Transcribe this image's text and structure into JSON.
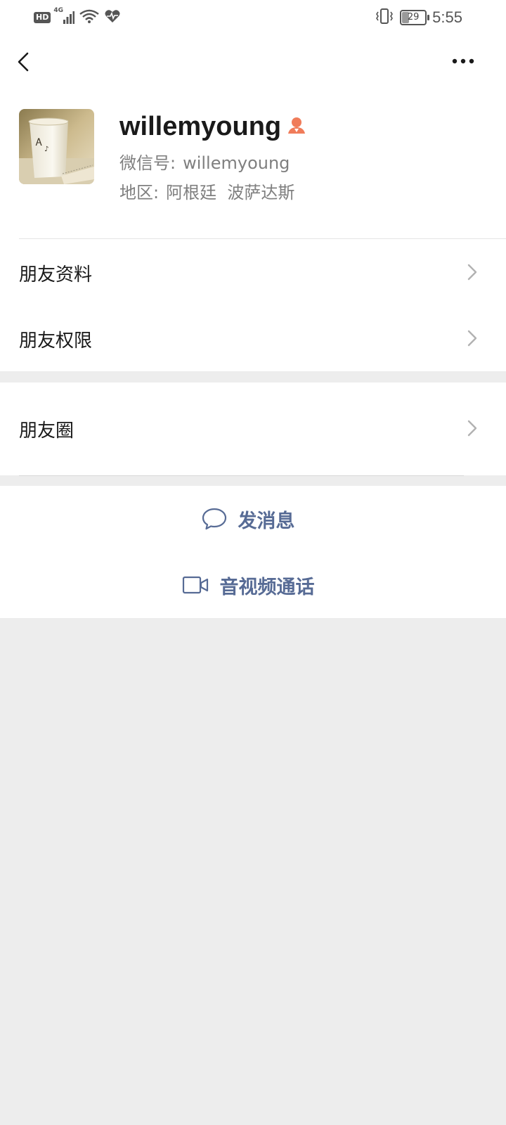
{
  "status_bar": {
    "hd": "HD",
    "network": "4G",
    "battery": "29",
    "time": "5:55"
  },
  "profile": {
    "nickname": "willemyoung",
    "wechat_id_label": "微信号:",
    "wechat_id": "willemyoung",
    "region_label": "地区:",
    "region": "阿根廷  波萨达斯"
  },
  "menu": {
    "friend_info": "朋友资料",
    "friend_permissions": "朋友权限",
    "moments": "朋友圈"
  },
  "actions": {
    "send_message": "发消息",
    "video_call": "音视频通话"
  },
  "colors": {
    "link_blue": "#576b95",
    "gender_icon": "#f07c5a",
    "background": "#ededed"
  }
}
